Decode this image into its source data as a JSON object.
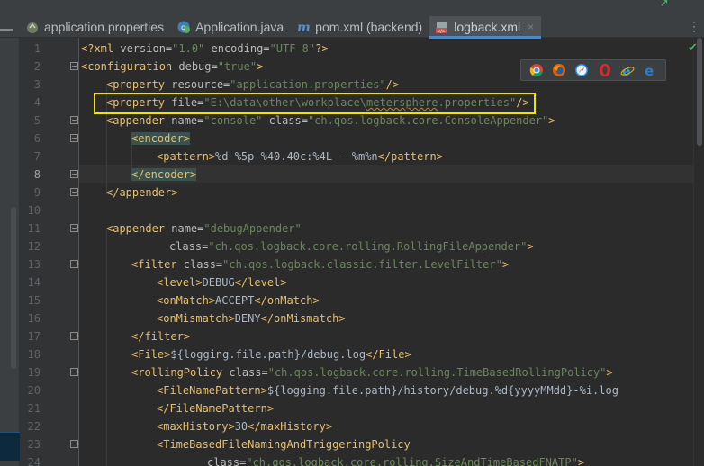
{
  "tabs": [
    {
      "label": "application.properties",
      "icon": "properties-file-icon",
      "active": false
    },
    {
      "label": "Application.java",
      "icon": "java-class-icon",
      "active": false
    },
    {
      "label": "pom.xml (backend)",
      "icon": "maven-icon",
      "active": false
    },
    {
      "label": "logback.xml",
      "icon": "xml-file-icon",
      "active": true
    }
  ],
  "close_glyph": "×",
  "overflow_glyph": "⋮",
  "line_numbers": [
    "1",
    "2",
    "3",
    "4",
    "5",
    "6",
    "7",
    "8",
    "9",
    "10",
    "11",
    "12",
    "13",
    "14",
    "15",
    "16",
    "17",
    "18",
    "19",
    "20",
    "21",
    "22",
    "23",
    "24"
  ],
  "current_line": "8",
  "code": {
    "l1": {
      "pi_open": "<?xml ",
      "a1": "version=",
      "v1": "\"1.0\"",
      "a2": " encoding=",
      "v2": "\"UTF-8\"",
      "pi_close": "?>"
    },
    "l2": {
      "tag": "<configuration ",
      "a1": "debug=",
      "v1": "\"true\"",
      "close": ">"
    },
    "l3": {
      "tag": "<property ",
      "a1": "resource=",
      "v1": "\"application.properties\"",
      "close": "/>"
    },
    "l4": {
      "tag": "<property ",
      "a1": "file=",
      "v1a": "\"E:\\data\\other\\workplace\\",
      "v1b": "metersphere",
      "v1c": ".properties\"",
      "close": "/>"
    },
    "l5": {
      "tag": "<appender ",
      "a1": "name=",
      "v1": "\"console\"",
      "a2": " class=",
      "v2": "\"ch.qos.logback.core.ConsoleAppender\"",
      "close": ">"
    },
    "l6": {
      "tag": "<encoder>"
    },
    "l7": {
      "open": "<pattern>",
      "text": "%d %5p %40.40c:%4L - %m%n",
      "close": "</pattern>"
    },
    "l8": {
      "tag": "</encoder>"
    },
    "l9": {
      "tag": "</appender>"
    },
    "l11": {
      "tag": "<appender ",
      "a1": "name=",
      "v1": "\"debugAppender\""
    },
    "l12": {
      "a1": "class=",
      "v1": "\"ch.qos.logback.core.rolling.RollingFileAppender\"",
      "close": ">"
    },
    "l13": {
      "tag": "<filter ",
      "a1": "class=",
      "v1": "\"ch.qos.logback.classic.filter.LevelFilter\"",
      "close": ">"
    },
    "l14": {
      "open": "<level>",
      "text": "DEBUG",
      "close": "</level>"
    },
    "l15": {
      "open": "<onMatch>",
      "text": "ACCEPT",
      "close": "</onMatch>"
    },
    "l16": {
      "open": "<onMismatch>",
      "text": "DENY",
      "close": "</onMismatch>"
    },
    "l17": {
      "tag": "</filter>"
    },
    "l18": {
      "open": "<File>",
      "text": "${logging.file.path}/debug.log",
      "close": "</File>"
    },
    "l19": {
      "tag": "<rollingPolicy ",
      "a1": "class=",
      "v1": "\"ch.qos.logback.core.rolling.TimeBasedRollingPolicy\"",
      "close": ">"
    },
    "l20": {
      "open": "<FileNamePattern>",
      "text": "${logging.file.path}/history/debug.%d{yyyyMMdd}-%i.log"
    },
    "l21": {
      "tag": "</FileNamePattern>"
    },
    "l22": {
      "open": "<maxHistory>",
      "text": "30",
      "close": "</maxHistory>"
    },
    "l23": {
      "tag": "<TimeBasedFileNamingAndTriggeringPolicy"
    },
    "l24": {
      "a1": "class=",
      "v1": "\"ch.qos.logback.core.rolling.SizeAndTimeBasedFNATP\"",
      "close": ">"
    }
  },
  "browsers": [
    "chrome-icon",
    "firefox-icon",
    "safari-icon",
    "opera-icon",
    "internet-explorer-icon",
    "edge-icon"
  ],
  "colors": {
    "tag": "#e8bf6a",
    "attr": "#bababa",
    "value": "#6a8759",
    "text": "#a9b7c6",
    "highlight_box": "#f2e400",
    "active_tab_underline": "#4a88c7"
  }
}
